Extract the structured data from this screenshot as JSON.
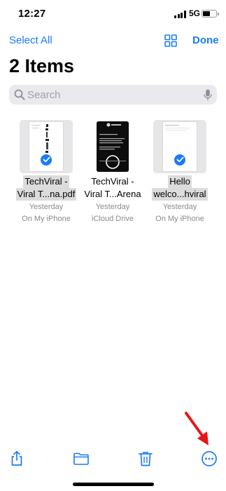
{
  "status": {
    "time": "12:27",
    "network": "5G"
  },
  "nav": {
    "select_all": "Select All",
    "done": "Done"
  },
  "title": "2 Items",
  "search": {
    "placeholder": "Search"
  },
  "files": [
    {
      "name_line1": "TechViral -",
      "name_line2": "Viral T...na.pdf",
      "date": "Yesterday",
      "location": "On My iPhone",
      "selected": true
    },
    {
      "name_line1": "TechViral -",
      "name_line2": "Viral T...Arena",
      "date": "Yesterday",
      "location": "iCloud Drive",
      "selected": false
    },
    {
      "name_line1": "Hello",
      "name_line2": "welco...hviral",
      "date": "Yesterday",
      "location": "On My iPhone",
      "selected": true
    }
  ],
  "toolbar": {
    "icons": [
      "share-icon",
      "folder-icon",
      "trash-icon",
      "more-icon"
    ]
  },
  "colors": {
    "accent": "#1a7cf5",
    "annotation_arrow": "#e8161b"
  }
}
